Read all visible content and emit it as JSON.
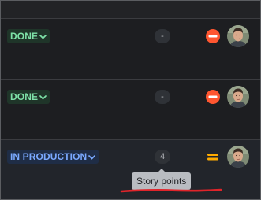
{
  "rows": [
    {
      "status": "DONE",
      "status_kind": "done",
      "story_points": "-",
      "priority_icon": "blocker-icon",
      "avatar_icon": "user-avatar"
    },
    {
      "status": "DONE",
      "status_kind": "done",
      "story_points": "-",
      "priority_icon": "blocker-icon",
      "avatar_icon": "user-avatar"
    },
    {
      "status": "IN PRODUCTION",
      "status_kind": "in-production",
      "story_points": "4",
      "priority_icon": "medium-priority-icon",
      "avatar_icon": "user-avatar"
    }
  ],
  "tooltip": {
    "text": "Story points"
  },
  "colors": {
    "done": "#7ee2a8",
    "in_production": "#7aa9ff",
    "blocker": "#ff5630",
    "medium": "#ffab00",
    "annotation_underline": "#e0242a"
  }
}
